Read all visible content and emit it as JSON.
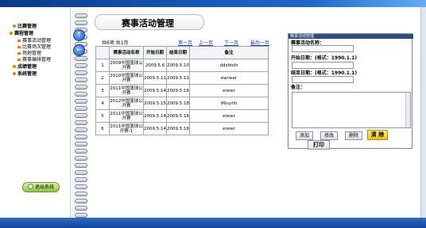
{
  "page": {
    "title": "赛事活动管理"
  },
  "nav": {
    "section1": "比赛管理",
    "section2": "赛程管理",
    "sub_items": [
      "赛事活动管理",
      "比赛场次管理",
      "场地管理",
      "赛事编排管理"
    ],
    "section3": "成绩管理",
    "section4": "系统管理",
    "exit_label": "退出系统"
  },
  "pager": {
    "summary": "共6项  共1页",
    "first": "第一页",
    "prev": "上一页",
    "next": "下一页",
    "last": "最后一页"
  },
  "table": {
    "headers": [
      "",
      "赛事活动名称",
      "开始日期",
      "结束日期",
      "备注"
    ],
    "rows": [
      [
        "1",
        "2009中国篮球公开赛",
        "2009.5.6",
        "2009.5.10",
        "ddsfdsfs"
      ],
      [
        "2",
        "2010中国篮球公开赛",
        "2009.5.11",
        "2009.5.11",
        "ewrwer"
      ],
      [
        "3",
        "2011中国篮球公开赛",
        "2009.5.14",
        "2009.5.16",
        "erewr"
      ],
      [
        "4",
        "2012中国篮球公开赛",
        "2009.5.15",
        "2009.5.18",
        "99uyhh"
      ],
      [
        "5",
        "2011中国篮球公开赛",
        "2009.5.14",
        "2009.5.16",
        "erewr"
      ],
      [
        "6",
        "2011中国篮球公开赛-1",
        "2009.5.14",
        "2009.5.16",
        "erewr"
      ]
    ]
  },
  "form": {
    "header": "赛事活动管理",
    "name_label": "赛事活动名称：",
    "start_label": "开始日期：(格式：1990.1.1)",
    "end_label": "结束日期：(格式：1990.1.1)",
    "remark_label": "备注：",
    "add": "添加",
    "edit": "修改",
    "delete": "删除",
    "clear": "清 除",
    "print": "打印"
  }
}
